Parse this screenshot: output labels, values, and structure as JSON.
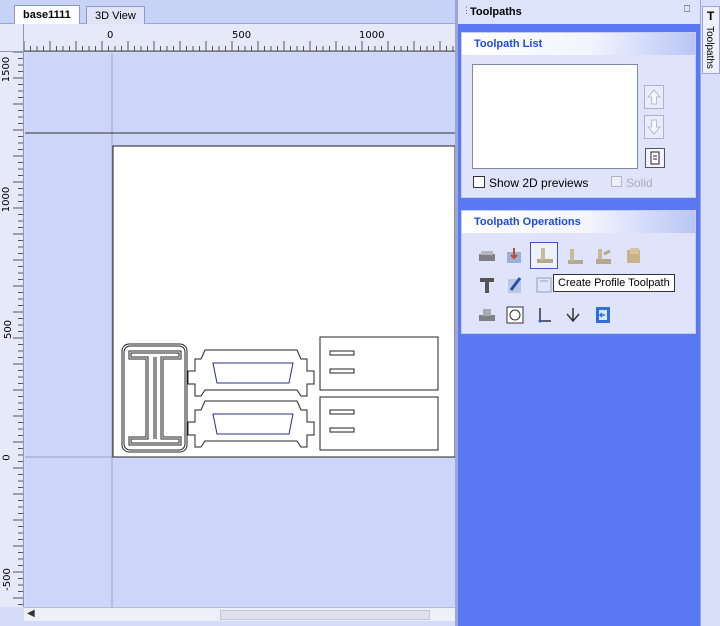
{
  "tabs": [
    {
      "label": "base1111",
      "active": true
    },
    {
      "label": "3D View",
      "active": false
    }
  ],
  "ruler": {
    "horizontal_labels": [
      "0",
      "500",
      "1000"
    ],
    "vertical_labels": [
      "1500",
      "1000",
      "500",
      "0",
      "-500"
    ]
  },
  "toolpaths_panel": {
    "title": "Toolpaths",
    "list_header": "Toolpath List",
    "show_2d_previews_label": "Show 2D previews",
    "show_2d_previews_checked": false,
    "solid_label": "Solid",
    "solid_enabled": false,
    "operations_header": "Toolpath Operations",
    "tooltip": "Create Profile Toolpath",
    "operations_rows": [
      [
        "drill-icon",
        "pocket-icon",
        "profile-icon",
        "vcarve-icon",
        "chamfer-icon",
        "texture-icon"
      ],
      [
        "text-icon",
        "edit-icon",
        "fluting-icon"
      ],
      [
        "machine-icon",
        "merge-icon",
        "anchor-icon",
        "fork-icon",
        "exit-icon"
      ]
    ]
  },
  "side_tab": {
    "label": "Toolpaths"
  },
  "colors": {
    "panel_blue": "#5a78f2",
    "header_text": "#1d4bd8",
    "canvas_bg": "#cdd6fa"
  }
}
